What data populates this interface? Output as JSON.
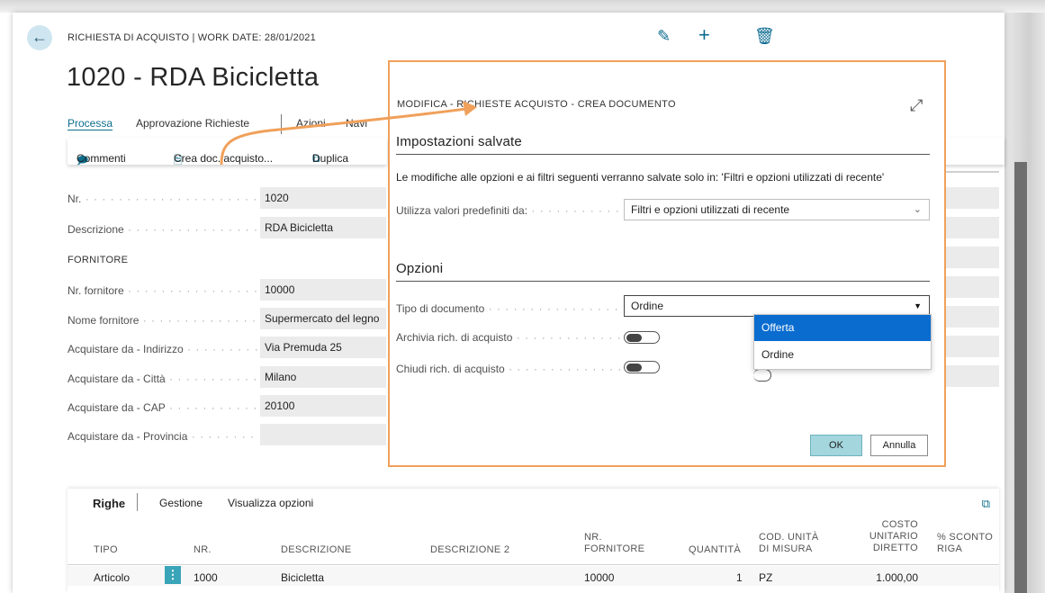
{
  "header": {
    "breadcrumb": "RICHIESTA DI ACQUISTO | WORK DATE: 28/01/2021",
    "title": "1020 - RDA Bicicletta",
    "icons": [
      "back-arrow-icon",
      "pencil-icon",
      "plus-icon",
      "trash-icon"
    ]
  },
  "tabs": [
    {
      "label": "Processa"
    },
    {
      "label": "Approvazione Richieste"
    },
    {
      "label": "Azioni"
    },
    {
      "label": "Navi"
    }
  ],
  "actions": {
    "commenti": "Commenti",
    "crea_doc": "Crea doc. acquisto...",
    "duplica": "Duplica"
  },
  "fields": [
    {
      "label": "Nr.",
      "value": "1020"
    },
    {
      "label": "Descrizione",
      "value": "RDA Bicicletta"
    },
    {
      "label": "Nr. fornitore",
      "value": "10000"
    },
    {
      "label": "Nome fornitore",
      "value": "Supermercato del legno"
    },
    {
      "label": "Acquistare da - Indirizzo",
      "value": "Via Premuda 25"
    },
    {
      "label": "Acquistare da - Città",
      "value": "Milano"
    },
    {
      "label": "Acquistare da - CAP",
      "value": "20100"
    },
    {
      "label": "Acquistare da - Provincia",
      "value": ""
    }
  ],
  "section_fornitore": "FORNITORE",
  "lines": {
    "title": "Righe",
    "gestione": "Gestione",
    "visualizza": "Visualizza opzioni",
    "headers": {
      "tipo": "TIPO",
      "nr": "NR.",
      "descrizione": "DESCRIZIONE",
      "descrizione2": "DESCRIZIONE 2",
      "nr_fornitore_1": "NR.",
      "nr_fornitore_2": "FORNITORE",
      "quantita": "QUANTITÀ",
      "cod_unita_1": "COD. UNITÀ",
      "cod_unita_2": "DI MISURA",
      "costo_1": "COSTO",
      "costo_2": "UNITARIO",
      "costo_3": "DIRETTO",
      "sconto_1": "% SCONTO",
      "sconto_2": "RIGA"
    },
    "rows": [
      {
        "tipo": "Articolo",
        "nr": "1000",
        "descrizione": "Bicicletta",
        "descrizione2": "",
        "nr_fornitore": "10000",
        "quantita": "1",
        "unita": "PZ",
        "costo": "1.000,00",
        "sconto": ""
      }
    ]
  },
  "modal": {
    "title": "MODIFICA - RICHIESTE ACQUISTO - CREA DOCUMENTO",
    "saved_heading": "Impostazioni salvate",
    "note": "Le modifiche alle opzioni e ai filtri seguenti verranno salvate solo in: 'Filtri e opzioni utilizzati di recente'",
    "use_defaults_label": "Utilizza valori predefiniti da:",
    "use_defaults_value": "Filtri e opzioni utilizzati di recente",
    "options_heading": "Opzioni",
    "doc_type_label": "Tipo di documento",
    "doc_type_value": "Ordine",
    "doc_type_options": [
      "Offerta",
      "Ordine"
    ],
    "archive_label": "Archivia rich. di acquisto",
    "archive_on": false,
    "close_label": "Chiudi rich. di acquisto",
    "close_on": false,
    "ok": "OK",
    "cancel": "Annulla"
  },
  "colors": {
    "accent": "#0e6e8c",
    "highlight_border": "#f0a05a",
    "dropdown_selected": "#0a6ccf",
    "ok_button": "#a3d6dd"
  }
}
